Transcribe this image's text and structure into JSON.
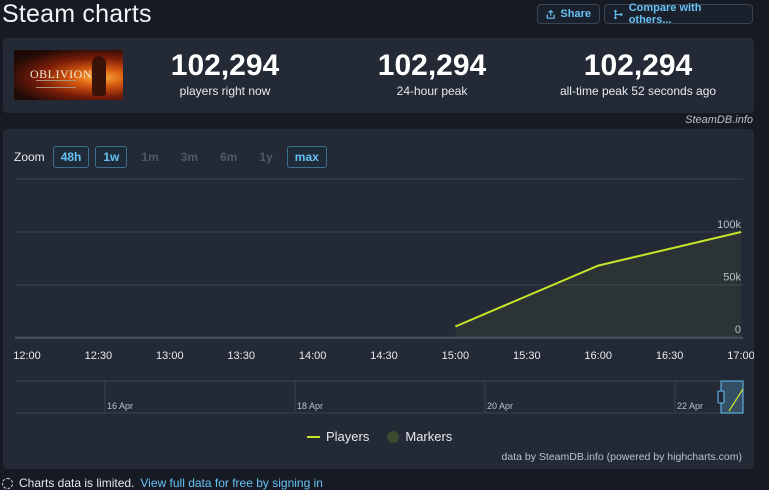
{
  "page": {
    "title": "Steam charts"
  },
  "header": {
    "share_label": "Share",
    "compare_label": "Compare with others..."
  },
  "stats": {
    "game_logo_text": "OBLIVION",
    "items": [
      {
        "value": "102,294",
        "label": "players right now"
      },
      {
        "value": "102,294",
        "label": "24-hour peak"
      },
      {
        "value": "102,294",
        "label": "all-time peak 52 seconds ago"
      }
    ],
    "credit": "SteamDB.info"
  },
  "chart": {
    "zoom_label": "Zoom",
    "zoom_options": [
      {
        "label": "48h",
        "active": true
      },
      {
        "label": "1w",
        "active": true
      },
      {
        "label": "1m",
        "active": false
      },
      {
        "label": "3m",
        "active": false
      },
      {
        "label": "6m",
        "active": false
      },
      {
        "label": "1y",
        "active": false
      },
      {
        "label": "max",
        "active": true
      }
    ],
    "legend": {
      "players": "Players",
      "markers": "Markers"
    },
    "credit": "data by SteamDB.info (powered by highcharts.com)",
    "navigator_labels": [
      "16 Apr",
      "18 Apr",
      "20 Apr",
      "22 Apr"
    ]
  },
  "chart_data": {
    "type": "line",
    "x_ticks": [
      "12:00",
      "12:30",
      "13:00",
      "13:30",
      "14:00",
      "14:30",
      "15:00",
      "15:30",
      "16:00",
      "16:30",
      "17:00"
    ],
    "y_ticks": [
      "0",
      "50k",
      "100k"
    ],
    "ylim": [
      0,
      100000
    ],
    "series": [
      {
        "name": "Players",
        "color": "#c6e52a",
        "x": [
          "15:00",
          "16:00",
          "17:00"
        ],
        "values": [
          10000,
          68000,
          100000
        ]
      }
    ]
  },
  "notice": {
    "text": "Charts data is limited.",
    "link": "View full data for free by signing in"
  },
  "colors": {
    "accent": "#67c1f5",
    "series": "#c6e52a",
    "background": "#161a22",
    "card": "#232a35"
  }
}
